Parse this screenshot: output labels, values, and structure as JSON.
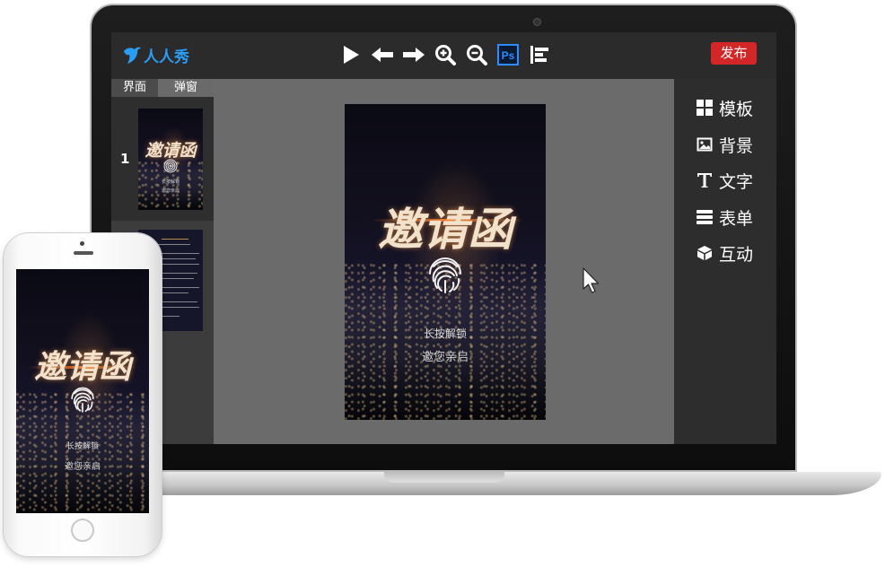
{
  "app": {
    "brand": "人人秀",
    "publish_label": "发布"
  },
  "toolbar": {
    "tools": [
      {
        "name": "play-icon"
      },
      {
        "name": "arrow-left-icon"
      },
      {
        "name": "arrow-right-icon"
      },
      {
        "name": "zoom-in-icon"
      },
      {
        "name": "zoom-out-icon"
      },
      {
        "name": "photoshop-icon",
        "label": "Ps"
      },
      {
        "name": "align-left-icon"
      }
    ]
  },
  "left_panel": {
    "tabs": [
      "界面",
      "弹窗"
    ],
    "active_tab": 0,
    "pages": [
      {
        "number": "1"
      }
    ]
  },
  "poster": {
    "title": "邀请函",
    "hint": "长按解锁",
    "subtitle": "邀您亲启"
  },
  "right_panel": {
    "items": [
      {
        "icon": "template-icon",
        "label": "模板"
      },
      {
        "icon": "background-image-icon",
        "label": "背景"
      },
      {
        "icon": "text-icon",
        "label": "文字"
      },
      {
        "icon": "form-icon",
        "label": "表单"
      },
      {
        "icon": "interaction-cube-icon",
        "label": "互动"
      }
    ]
  },
  "colors": {
    "brand_blue": "#2a9df4",
    "publish_red": "#d32626",
    "photoshop_blue": "#2d8cff"
  }
}
